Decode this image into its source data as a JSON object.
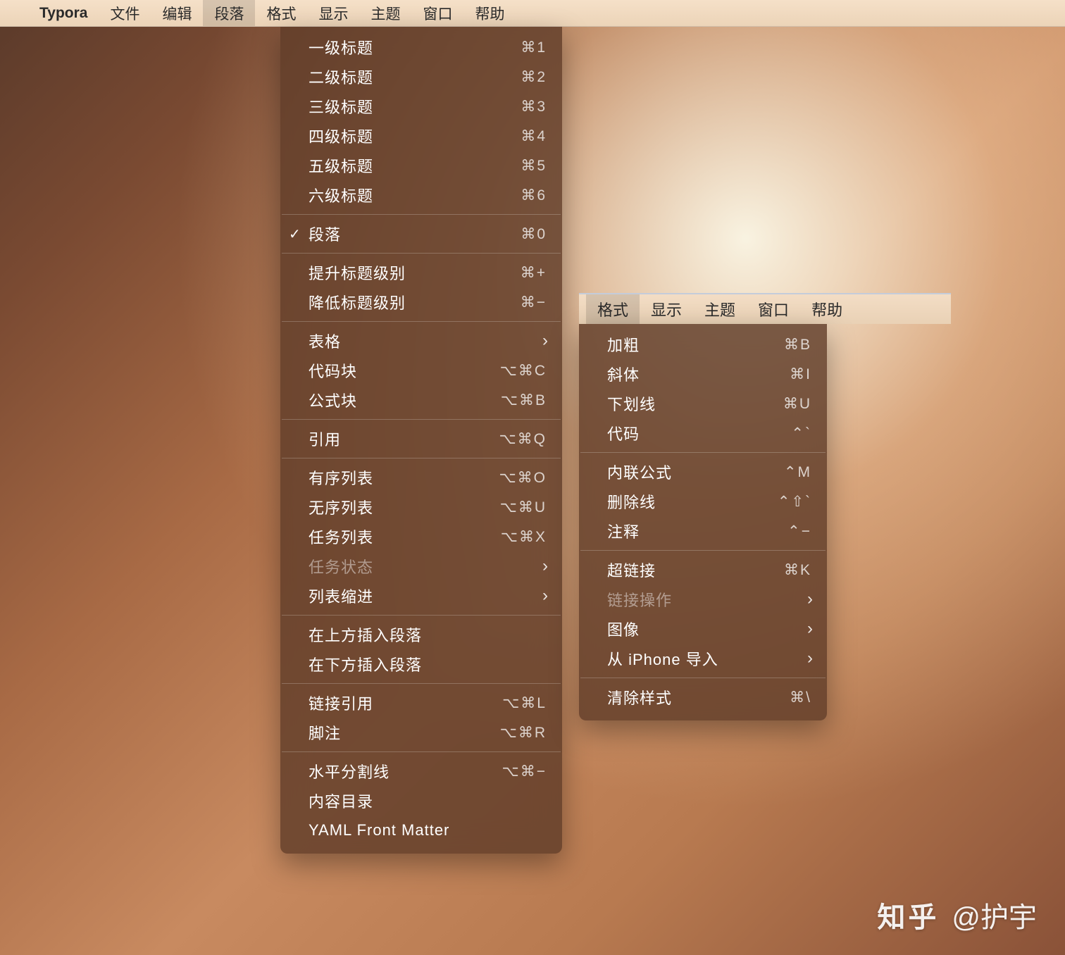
{
  "menubar": {
    "app": "Typora",
    "items": [
      "文件",
      "编辑",
      "段落",
      "格式",
      "显示",
      "主题",
      "窗口",
      "帮助"
    ],
    "active_index": 2
  },
  "paragraph_menu": {
    "groups": [
      [
        {
          "label": "一级标题",
          "shortcut": "⌘1"
        },
        {
          "label": "二级标题",
          "shortcut": "⌘2"
        },
        {
          "label": "三级标题",
          "shortcut": "⌘3"
        },
        {
          "label": "四级标题",
          "shortcut": "⌘4"
        },
        {
          "label": "五级标题",
          "shortcut": "⌘5"
        },
        {
          "label": "六级标题",
          "shortcut": "⌘6"
        }
      ],
      [
        {
          "label": "段落",
          "shortcut": "⌘0",
          "checked": true
        }
      ],
      [
        {
          "label": "提升标题级别",
          "shortcut": "⌘+"
        },
        {
          "label": "降低标题级别",
          "shortcut": "⌘−"
        }
      ],
      [
        {
          "label": "表格",
          "submenu": true
        },
        {
          "label": "代码块",
          "shortcut": "⌥⌘C"
        },
        {
          "label": "公式块",
          "shortcut": "⌥⌘B"
        }
      ],
      [
        {
          "label": "引用",
          "shortcut": "⌥⌘Q"
        }
      ],
      [
        {
          "label": "有序列表",
          "shortcut": "⌥⌘O"
        },
        {
          "label": "无序列表",
          "shortcut": "⌥⌘U"
        },
        {
          "label": "任务列表",
          "shortcut": "⌥⌘X"
        },
        {
          "label": "任务状态",
          "submenu": true,
          "disabled": true
        },
        {
          "label": "列表缩进",
          "submenu": true
        }
      ],
      [
        {
          "label": "在上方插入段落"
        },
        {
          "label": "在下方插入段落"
        }
      ],
      [
        {
          "label": "链接引用",
          "shortcut": "⌥⌘L"
        },
        {
          "label": "脚注",
          "shortcut": "⌥⌘R"
        }
      ],
      [
        {
          "label": "水平分割线",
          "shortcut": "⌥⌘−"
        },
        {
          "label": "内容目录"
        },
        {
          "label": "YAML Front Matter"
        }
      ]
    ]
  },
  "mini_menubar": {
    "items": [
      "格式",
      "显示",
      "主题",
      "窗口",
      "帮助"
    ],
    "active_index": 0
  },
  "format_menu": {
    "groups": [
      [
        {
          "label": "加粗",
          "shortcut": "⌘B"
        },
        {
          "label": "斜体",
          "shortcut": "⌘I"
        },
        {
          "label": "下划线",
          "shortcut": "⌘U"
        },
        {
          "label": "代码",
          "shortcut": "⌃`"
        }
      ],
      [
        {
          "label": "内联公式",
          "shortcut": "⌃M"
        },
        {
          "label": "删除线",
          "shortcut": "⌃⇧`"
        },
        {
          "label": "注释",
          "shortcut": "⌃−"
        }
      ],
      [
        {
          "label": "超链接",
          "shortcut": "⌘K"
        },
        {
          "label": "链接操作",
          "submenu": true,
          "disabled": true
        },
        {
          "label": "图像",
          "submenu": true
        },
        {
          "label": "从 iPhone 导入",
          "submenu": true
        }
      ],
      [
        {
          "label": "清除样式",
          "shortcut": "⌘\\"
        }
      ]
    ]
  },
  "watermark": {
    "brand": "知乎",
    "author": "@护宇"
  }
}
